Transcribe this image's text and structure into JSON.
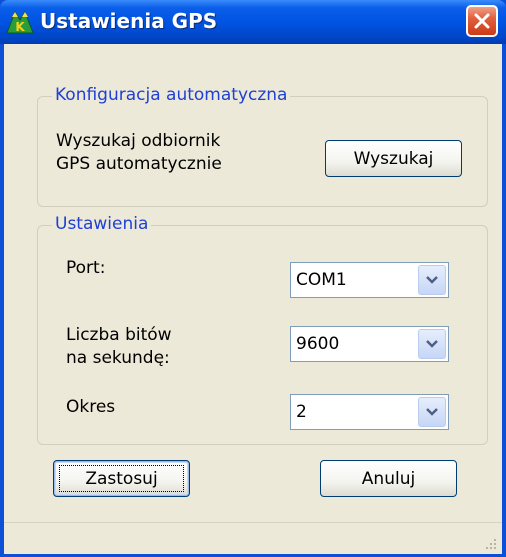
{
  "window": {
    "title": "Ustawienia GPS",
    "app_icon": "mountain-k-icon",
    "close_icon": "close-icon",
    "title_color": "#0054e3",
    "close_color": "#e0603e"
  },
  "auto_config": {
    "legend": "Konfiguracja automatyczna",
    "description_line1": "Wyszukaj odbiornik",
    "description_line2": "GPS automatycznie",
    "search_button": "Wyszukaj"
  },
  "settings": {
    "legend": "Ustawienia",
    "port_label": "Port:",
    "port_value": "COM1",
    "baud_label_line1": "Liczba bitów",
    "baud_label_line2": "na sekundę:",
    "baud_value": "9600",
    "period_label": "Okres",
    "period_value": "2",
    "dropdown_icon": "chevron-down-icon"
  },
  "actions": {
    "apply_button": "Zastosuj",
    "cancel_button": "Anuluj"
  },
  "colors": {
    "legend_text": "#1f3fd6",
    "dialog_background": "#ece9d8"
  }
}
